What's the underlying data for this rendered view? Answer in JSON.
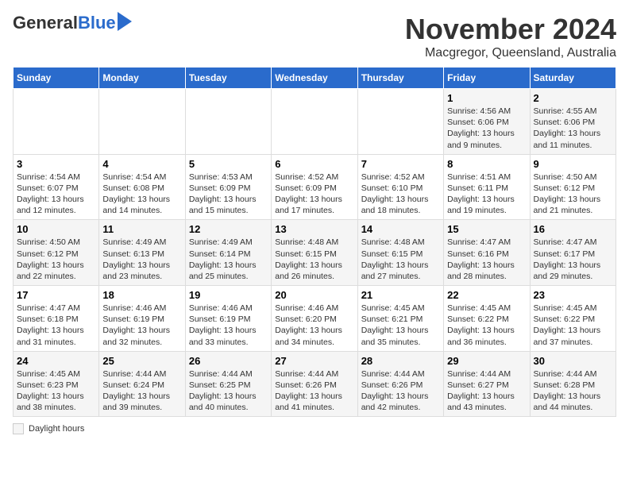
{
  "logo": {
    "general": "General",
    "blue": "Blue"
  },
  "title": "November 2024",
  "subtitle": "Macgregor, Queensland, Australia",
  "columns": [
    "Sunday",
    "Monday",
    "Tuesday",
    "Wednesday",
    "Thursday",
    "Friday",
    "Saturday"
  ],
  "weeks": [
    [
      {
        "day": "",
        "info": ""
      },
      {
        "day": "",
        "info": ""
      },
      {
        "day": "",
        "info": ""
      },
      {
        "day": "",
        "info": ""
      },
      {
        "day": "",
        "info": ""
      },
      {
        "day": "1",
        "info": "Sunrise: 4:56 AM\nSunset: 6:06 PM\nDaylight: 13 hours and 9 minutes."
      },
      {
        "day": "2",
        "info": "Sunrise: 4:55 AM\nSunset: 6:06 PM\nDaylight: 13 hours and 11 minutes."
      }
    ],
    [
      {
        "day": "3",
        "info": "Sunrise: 4:54 AM\nSunset: 6:07 PM\nDaylight: 13 hours and 12 minutes."
      },
      {
        "day": "4",
        "info": "Sunrise: 4:54 AM\nSunset: 6:08 PM\nDaylight: 13 hours and 14 minutes."
      },
      {
        "day": "5",
        "info": "Sunrise: 4:53 AM\nSunset: 6:09 PM\nDaylight: 13 hours and 15 minutes."
      },
      {
        "day": "6",
        "info": "Sunrise: 4:52 AM\nSunset: 6:09 PM\nDaylight: 13 hours and 17 minutes."
      },
      {
        "day": "7",
        "info": "Sunrise: 4:52 AM\nSunset: 6:10 PM\nDaylight: 13 hours and 18 minutes."
      },
      {
        "day": "8",
        "info": "Sunrise: 4:51 AM\nSunset: 6:11 PM\nDaylight: 13 hours and 19 minutes."
      },
      {
        "day": "9",
        "info": "Sunrise: 4:50 AM\nSunset: 6:12 PM\nDaylight: 13 hours and 21 minutes."
      }
    ],
    [
      {
        "day": "10",
        "info": "Sunrise: 4:50 AM\nSunset: 6:12 PM\nDaylight: 13 hours and 22 minutes."
      },
      {
        "day": "11",
        "info": "Sunrise: 4:49 AM\nSunset: 6:13 PM\nDaylight: 13 hours and 23 minutes."
      },
      {
        "day": "12",
        "info": "Sunrise: 4:49 AM\nSunset: 6:14 PM\nDaylight: 13 hours and 25 minutes."
      },
      {
        "day": "13",
        "info": "Sunrise: 4:48 AM\nSunset: 6:15 PM\nDaylight: 13 hours and 26 minutes."
      },
      {
        "day": "14",
        "info": "Sunrise: 4:48 AM\nSunset: 6:15 PM\nDaylight: 13 hours and 27 minutes."
      },
      {
        "day": "15",
        "info": "Sunrise: 4:47 AM\nSunset: 6:16 PM\nDaylight: 13 hours and 28 minutes."
      },
      {
        "day": "16",
        "info": "Sunrise: 4:47 AM\nSunset: 6:17 PM\nDaylight: 13 hours and 29 minutes."
      }
    ],
    [
      {
        "day": "17",
        "info": "Sunrise: 4:47 AM\nSunset: 6:18 PM\nDaylight: 13 hours and 31 minutes."
      },
      {
        "day": "18",
        "info": "Sunrise: 4:46 AM\nSunset: 6:19 PM\nDaylight: 13 hours and 32 minutes."
      },
      {
        "day": "19",
        "info": "Sunrise: 4:46 AM\nSunset: 6:19 PM\nDaylight: 13 hours and 33 minutes."
      },
      {
        "day": "20",
        "info": "Sunrise: 4:46 AM\nSunset: 6:20 PM\nDaylight: 13 hours and 34 minutes."
      },
      {
        "day": "21",
        "info": "Sunrise: 4:45 AM\nSunset: 6:21 PM\nDaylight: 13 hours and 35 minutes."
      },
      {
        "day": "22",
        "info": "Sunrise: 4:45 AM\nSunset: 6:22 PM\nDaylight: 13 hours and 36 minutes."
      },
      {
        "day": "23",
        "info": "Sunrise: 4:45 AM\nSunset: 6:22 PM\nDaylight: 13 hours and 37 minutes."
      }
    ],
    [
      {
        "day": "24",
        "info": "Sunrise: 4:45 AM\nSunset: 6:23 PM\nDaylight: 13 hours and 38 minutes."
      },
      {
        "day": "25",
        "info": "Sunrise: 4:44 AM\nSunset: 6:24 PM\nDaylight: 13 hours and 39 minutes."
      },
      {
        "day": "26",
        "info": "Sunrise: 4:44 AM\nSunset: 6:25 PM\nDaylight: 13 hours and 40 minutes."
      },
      {
        "day": "27",
        "info": "Sunrise: 4:44 AM\nSunset: 6:26 PM\nDaylight: 13 hours and 41 minutes."
      },
      {
        "day": "28",
        "info": "Sunrise: 4:44 AM\nSunset: 6:26 PM\nDaylight: 13 hours and 42 minutes."
      },
      {
        "day": "29",
        "info": "Sunrise: 4:44 AM\nSunset: 6:27 PM\nDaylight: 13 hours and 43 minutes."
      },
      {
        "day": "30",
        "info": "Sunrise: 4:44 AM\nSunset: 6:28 PM\nDaylight: 13 hours and 44 minutes."
      }
    ]
  ],
  "legend": {
    "color_label": "Daylight hours"
  }
}
